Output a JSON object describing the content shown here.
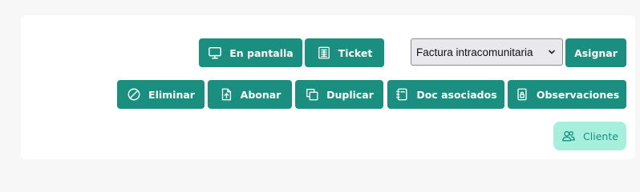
{
  "colors": {
    "primary": "#1a8f7f",
    "light": "#a6efdc",
    "panel": "#ffffff",
    "background": "#f7f7f7"
  },
  "toolbar_top": {
    "screen_label": "En pantalla",
    "screen_icon": "monitor-icon",
    "ticket_label": "Ticket",
    "ticket_icon": "receipt-icon",
    "invoice_type_value": "Factura intracomunitaria",
    "assign_label": "Asignar"
  },
  "toolbar_actions": [
    {
      "label": "Eliminar",
      "icon": "ban-icon"
    },
    {
      "label": "Abonar",
      "icon": "file-upload-icon"
    },
    {
      "label": "Duplicar",
      "icon": "copy-icon"
    },
    {
      "label": "Doc asociados",
      "icon": "notebook-icon"
    },
    {
      "label": "Observaciones",
      "icon": "lock-icon"
    }
  ],
  "client_button": {
    "label": "Cliente",
    "icon": "users-icon"
  }
}
